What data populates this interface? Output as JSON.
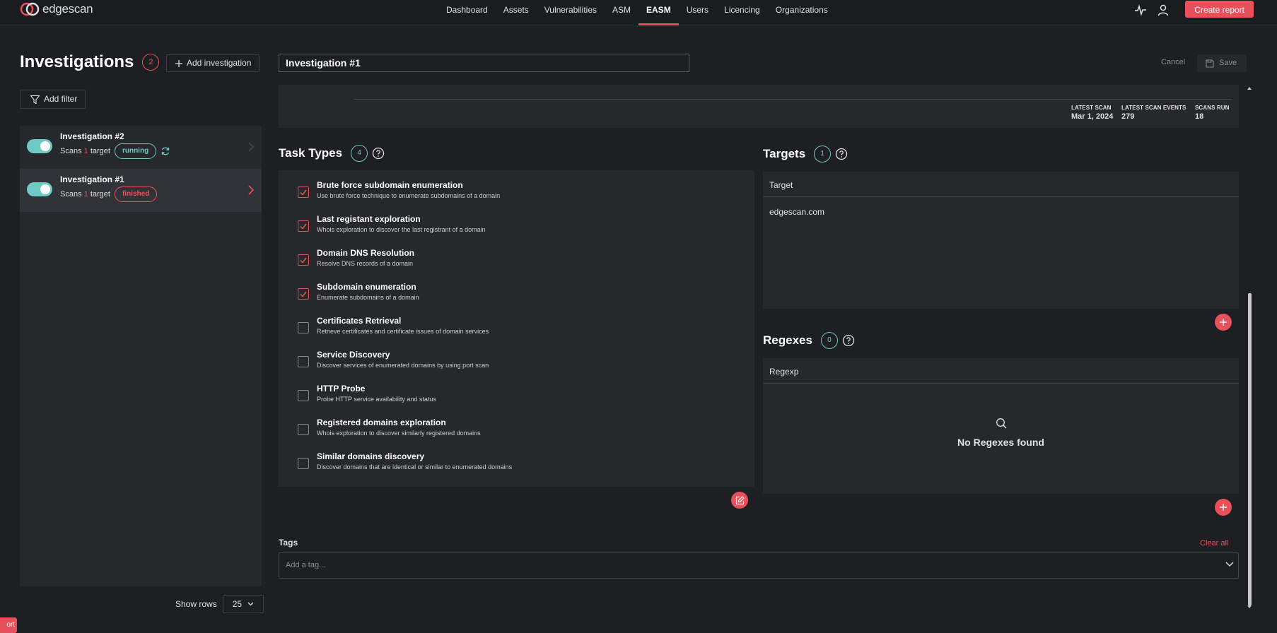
{
  "app": {
    "logo_text": "edgescan"
  },
  "nav": {
    "items": [
      "Dashboard",
      "Assets",
      "Vulnerabilities",
      "ASM",
      "EASM",
      "Users",
      "Licencing",
      "Organizations"
    ],
    "active": "EASM",
    "create_report": "Create report"
  },
  "sidebar": {
    "title": "Investigations",
    "count": "2",
    "add_investigation": "Add investigation",
    "add_filter": "Add filter",
    "investigations": [
      {
        "name": "Investigation #2",
        "scans_prefix": "Scans",
        "targets": "1",
        "targets_suffix": "target",
        "status": "running"
      },
      {
        "name": "Investigation #1",
        "scans_prefix": "Scans",
        "targets": "1",
        "targets_suffix": "target",
        "status": "finished"
      }
    ],
    "show_rows_label": "Show rows",
    "rows_value": "25",
    "report_tab": "ort"
  },
  "editor": {
    "name_value": "Investigation #1",
    "cancel": "Cancel",
    "save": "Save"
  },
  "stats": {
    "latest_scan_label": "LATEST SCAN",
    "latest_scan_value": "Mar 1, 2024",
    "latest_events_label": "LATEST SCAN EVENTS",
    "latest_events_value": "279",
    "scans_run_label": "SCANS RUN",
    "scans_run_value": "18"
  },
  "task_types": {
    "title": "Task Types",
    "count": "4",
    "tasks": [
      {
        "title": "Brute force subdomain enumeration",
        "desc": "Use brute force technique to enumerate subdomains of a domain",
        "checked": true
      },
      {
        "title": "Last registant exploration",
        "desc": "Whois exploration to discover the last registrant of a domain",
        "checked": true
      },
      {
        "title": "Domain DNS Resolution",
        "desc": "Resolve DNS records of a domain",
        "checked": true
      },
      {
        "title": "Subdomain enumeration",
        "desc": "Enumerate subdomains of a domain",
        "checked": true
      },
      {
        "title": "Certificates Retrieval",
        "desc": "Retrieve certificates and certificate issues of domain services",
        "checked": false
      },
      {
        "title": "Service Discovery",
        "desc": "Discover services of enumerated domains by using port scan",
        "checked": false
      },
      {
        "title": "HTTP Probe",
        "desc": "Probe HTTP service availability and status",
        "checked": false
      },
      {
        "title": "Registered domains exploration",
        "desc": "Whois exploration to discover similarly registered domains",
        "checked": false
      },
      {
        "title": "Similar domains discovery",
        "desc": "Discover domains that are identical or similar to enumerated domains",
        "checked": false
      }
    ]
  },
  "targets": {
    "title": "Targets",
    "count": "1",
    "column": "Target",
    "rows": [
      "edgescan.com"
    ]
  },
  "regexes": {
    "title": "Regexes",
    "count": "0",
    "column": "Regexp",
    "empty_text": "No Regexes found"
  },
  "tags": {
    "label": "Tags",
    "clear_all": "Clear all",
    "placeholder": "Add a tag..."
  },
  "colors": {
    "accent": "#e8505b",
    "teal": "#6fc9c5",
    "panel": "#27282c",
    "background": "#1e1f22"
  }
}
